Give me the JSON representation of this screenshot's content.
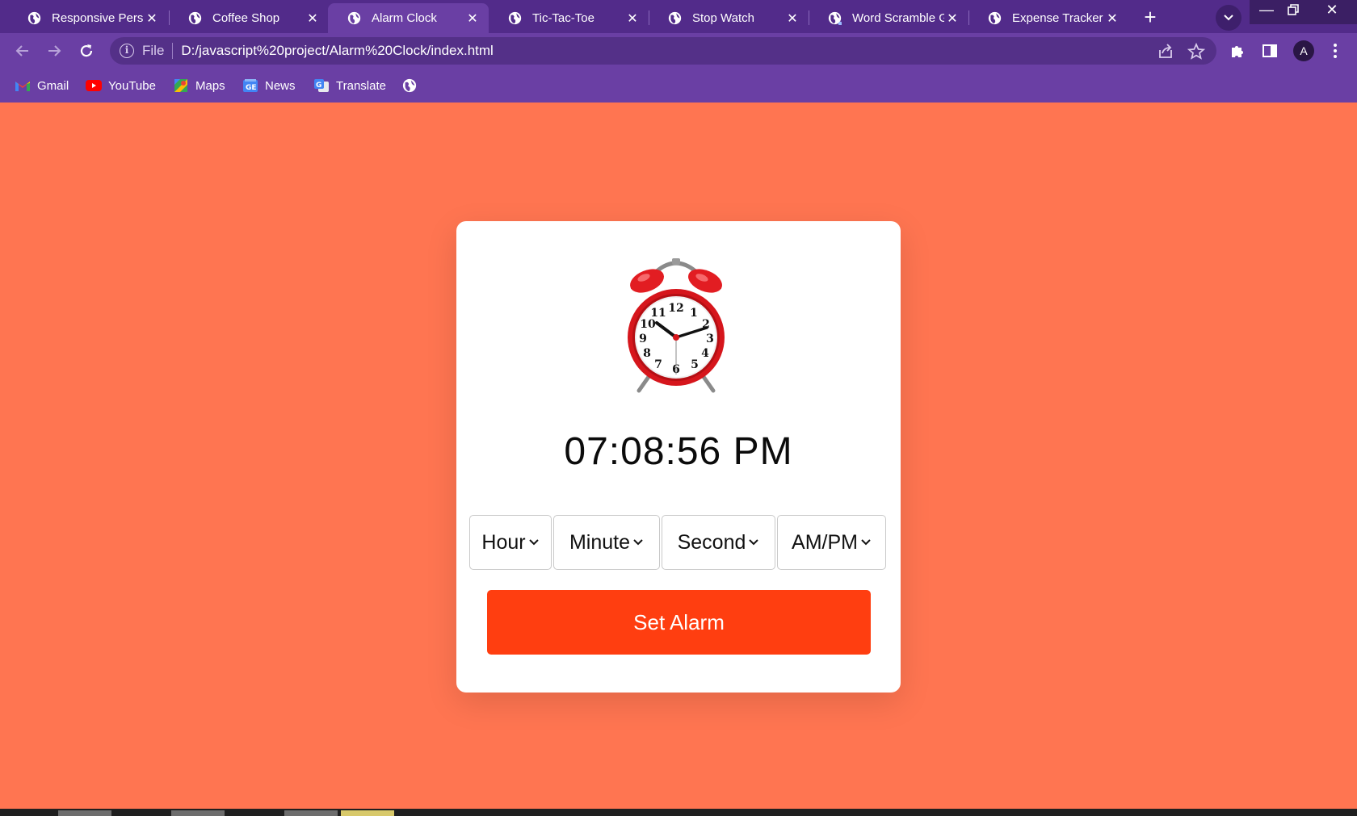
{
  "browser": {
    "tabs": [
      {
        "title": "Responsive Person",
        "active": false
      },
      {
        "title": "Coffee Shop",
        "active": false
      },
      {
        "title": "Alarm Clock",
        "active": true
      },
      {
        "title": "Tic-Tac-Toe",
        "active": false
      },
      {
        "title": "Stop Watch",
        "active": false
      },
      {
        "title": "Word Scramble G",
        "active": false
      },
      {
        "title": "Expense Tracker",
        "active": false
      }
    ],
    "address": {
      "scheme_label": "File",
      "url": "D:/javascript%20project/Alarm%20Clock/index.html"
    },
    "profile_initial": "A",
    "bookmarks": [
      {
        "label": "Gmail",
        "icon": "gmail-icon"
      },
      {
        "label": "YouTube",
        "icon": "youtube-icon"
      },
      {
        "label": "Maps",
        "icon": "maps-icon"
      },
      {
        "label": "News",
        "icon": "news-icon"
      },
      {
        "label": "Translate",
        "icon": "translate-icon"
      },
      {
        "label": "",
        "icon": "globe-icon"
      }
    ]
  },
  "page": {
    "current_time": "07:08:56 PM",
    "selects": {
      "hour": "Hour",
      "minute": "Minute",
      "second": "Second",
      "ampm": "AM/PM"
    },
    "set_alarm_label": "Set Alarm"
  },
  "colors": {
    "page_background": "#ff7551",
    "button": "#ff3e10",
    "browser_frame": "#522b8a",
    "toolbar": "#6a3fa4"
  }
}
